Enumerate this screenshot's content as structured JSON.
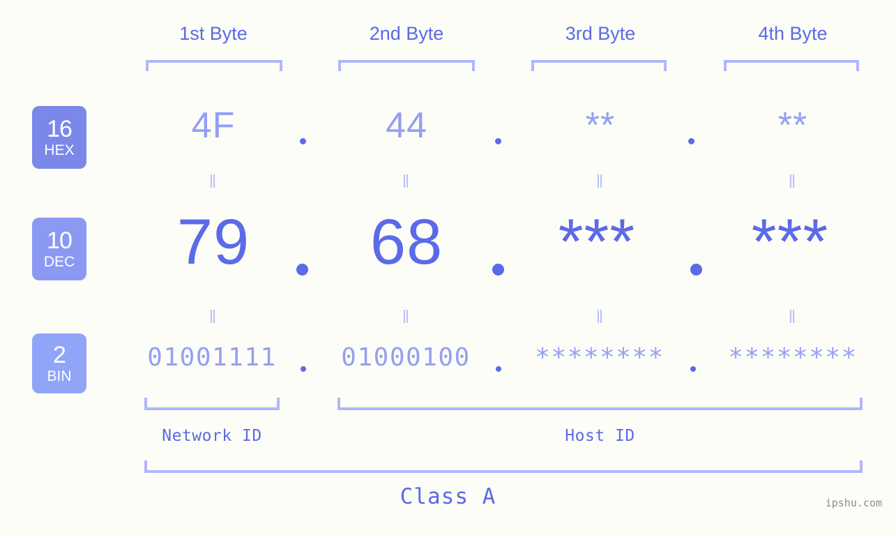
{
  "meta": {
    "background_color": "#fdfdf7",
    "accent_color": "#5a6ae8",
    "muted_color": "#93a0f3",
    "bracket_color": "#aeb8fb",
    "watermark": "ipshu.com"
  },
  "headers": [
    {
      "label": "1st Byte"
    },
    {
      "label": "2nd Byte"
    },
    {
      "label": "3rd Byte"
    },
    {
      "label": "4th Byte"
    }
  ],
  "bases": [
    {
      "number": "16",
      "name": "HEX",
      "color": "#7b87e9"
    },
    {
      "number": "10",
      "name": "DEC",
      "color": "#8b99f2"
    },
    {
      "number": "2",
      "name": "BIN",
      "color": "#90a5f8"
    }
  ],
  "rows": {
    "hex": {
      "values": [
        "4F",
        "44",
        "**",
        "**"
      ]
    },
    "dec": {
      "values": [
        "79",
        "68",
        "***",
        "***"
      ]
    },
    "bin": {
      "values": [
        "01001111",
        "01000100",
        "********",
        "********"
      ]
    }
  },
  "separators": {
    "hex": [
      ".",
      ".",
      "."
    ],
    "dec": [
      ".",
      ".",
      "."
    ],
    "bin": [
      ".",
      ".",
      "."
    ]
  },
  "equals": {
    "hex_to_dec": [
      "=",
      "=",
      "=",
      "="
    ],
    "dec_to_bin": [
      "=",
      "=",
      "=",
      "="
    ]
  },
  "id_labels": [
    {
      "label": "Network ID"
    },
    {
      "label": "Host ID"
    }
  ],
  "class_label": "Class A"
}
